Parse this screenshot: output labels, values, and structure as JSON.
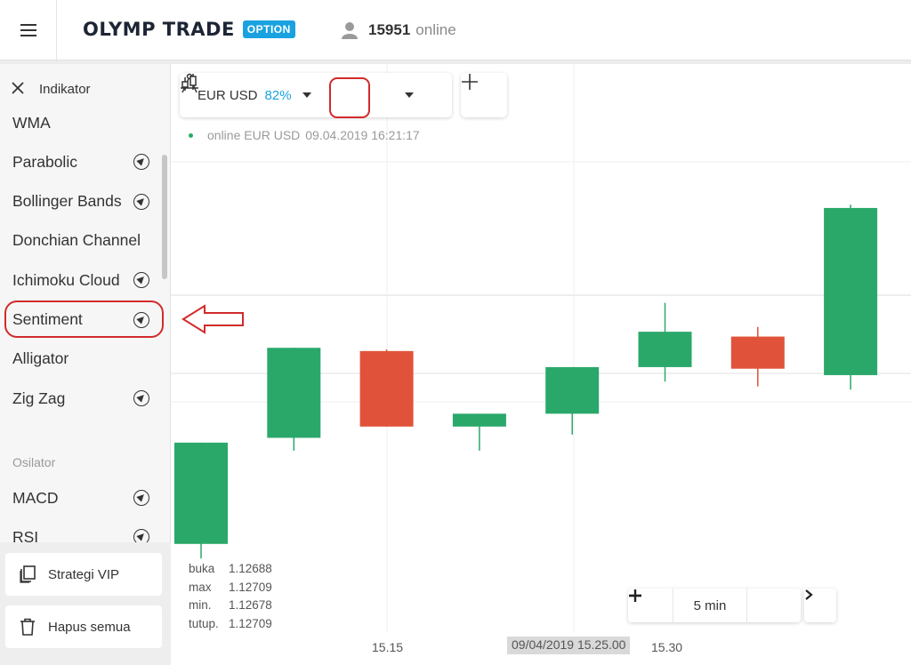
{
  "header": {
    "brand": "OLYMP TRADE",
    "brand_badge": "OPTION",
    "online_count": "15951",
    "online_label": "online"
  },
  "sidebar": {
    "title": "Indikator",
    "items": [
      {
        "label": "WMA",
        "has_icon": false
      },
      {
        "label": "Parabolic",
        "has_icon": true
      },
      {
        "label": "Bollinger Bands",
        "has_icon": true
      },
      {
        "label": "Donchian Channel",
        "has_icon": false
      },
      {
        "label": "Ichimoku Cloud",
        "has_icon": true
      },
      {
        "label": "Sentiment",
        "has_icon": true
      },
      {
        "label": "Alligator",
        "has_icon": false
      },
      {
        "label": "Zig Zag",
        "has_icon": true
      }
    ],
    "section_osilator": "Osilator",
    "osilator_items": [
      {
        "label": "MACD",
        "has_icon": true
      },
      {
        "label": "RSI",
        "has_icon": true
      }
    ],
    "strategy_button": "Strategi VIP",
    "clear_button": "Hapus semua"
  },
  "toolbar": {
    "asset": "EUR USD",
    "payout": "82%"
  },
  "status": {
    "label": "online EUR USD",
    "datetime": "09.04.2019 16:21:17"
  },
  "ohlc": {
    "open_label": "buka",
    "open_value": "1.12688",
    "max_label": "max",
    "max_value": "1.12709",
    "min_label": "min.",
    "min_value": "1.12678",
    "close_label": "tutup.",
    "close_value": "1.12709"
  },
  "timeframe": {
    "value": "5 min"
  },
  "x_axis": {
    "tick_1": "15.15",
    "tick_2": "15.30",
    "cursor_time": "09/04/2019 15.25.00"
  },
  "colors": {
    "up": "#2aa86a",
    "down": "#e0533a",
    "accent": "#1aa2e0",
    "highlight": "#d12b2b"
  },
  "candles": [
    {
      "dir": "up",
      "open": 1.12585,
      "close": 1.12648,
      "high": 1.12648,
      "low": 1.12576
    },
    {
      "dir": "up",
      "open": 1.12651,
      "close": 1.12707,
      "high": 1.12707,
      "low": 1.12643
    },
    {
      "dir": "down",
      "open": 1.12705,
      "close": 1.12658,
      "high": 1.12706,
      "low": 1.12658
    },
    {
      "dir": "up",
      "open": 1.12658,
      "close": 1.12666,
      "high": 1.12666,
      "low": 1.12643
    },
    {
      "dir": "up",
      "open": 1.12666,
      "close": 1.12695,
      "high": 1.12695,
      "low": 1.12653
    },
    {
      "dir": "up",
      "open": 1.12695,
      "close": 1.12717,
      "high": 1.12735,
      "low": 1.12686
    },
    {
      "dir": "down",
      "open": 1.12714,
      "close": 1.12694,
      "high": 1.1272,
      "low": 1.12683
    },
    {
      "dir": "up",
      "open": 1.1269,
      "close": 1.12794,
      "high": 1.12796,
      "low": 1.12681
    }
  ]
}
